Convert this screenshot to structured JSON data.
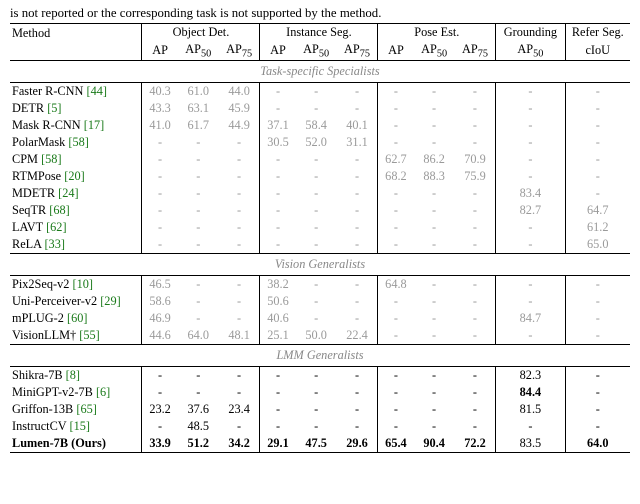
{
  "caption_tail": "is not reported or the corresponding task is not supported by the method.",
  "headers": {
    "method": "Method",
    "objdet": "Object Det.",
    "instseg": "Instance Seg.",
    "pose": "Pose Est.",
    "grounding": "Grounding",
    "referseg": "Refer Seg.",
    "ap": "AP",
    "ap50": "AP",
    "ap50_sub": "50",
    "ap75": "AP",
    "ap75_sub": "75",
    "ciou": "cIoU"
  },
  "sections": [
    {
      "title": "Task-specific Specialists",
      "rows": [
        {
          "name": "Faster R-CNN",
          "ref": "[44]",
          "gray": true,
          "od": [
            "40.3",
            "61.0",
            "44.0"
          ],
          "is": [
            "-",
            "-",
            "-"
          ],
          "pe": [
            "-",
            "-",
            "-"
          ],
          "gnd": "-",
          "ref_v": "-"
        },
        {
          "name": "DETR",
          "ref": "[5]",
          "gray": true,
          "od": [
            "43.3",
            "63.1",
            "45.9"
          ],
          "is": [
            "-",
            "-",
            "-"
          ],
          "pe": [
            "-",
            "-",
            "-"
          ],
          "gnd": "-",
          "ref_v": "-"
        },
        {
          "name": "Mask R-CNN",
          "ref": "[17]",
          "gray": true,
          "od": [
            "41.0",
            "61.7",
            "44.9"
          ],
          "is": [
            "37.1",
            "58.4",
            "40.1"
          ],
          "pe": [
            "-",
            "-",
            "-"
          ],
          "gnd": "-",
          "ref_v": "-"
        },
        {
          "name": "PolarMask",
          "ref": "[58]",
          "gray": true,
          "od": [
            "-",
            "-",
            "-"
          ],
          "is": [
            "30.5",
            "52.0",
            "31.1"
          ],
          "pe": [
            "-",
            "-",
            "-"
          ],
          "gnd": "-",
          "ref_v": "-"
        },
        {
          "name": "CPM",
          "ref": "[58]",
          "gray": true,
          "od": [
            "-",
            "-",
            "-"
          ],
          "is": [
            "-",
            "-",
            "-"
          ],
          "pe": [
            "62.7",
            "86.2",
            "70.9"
          ],
          "gnd": "-",
          "ref_v": "-"
        },
        {
          "name": "RTMPose",
          "ref": "[20]",
          "gray": true,
          "od": [
            "-",
            "-",
            "-"
          ],
          "is": [
            "-",
            "-",
            "-"
          ],
          "pe": [
            "68.2",
            "88.3",
            "75.9"
          ],
          "gnd": "-",
          "ref_v": "-"
        },
        {
          "name": "MDETR",
          "ref": "[24]",
          "gray": true,
          "od": [
            "-",
            "-",
            "-"
          ],
          "is": [
            "-",
            "-",
            "-"
          ],
          "pe": [
            "-",
            "-",
            "-"
          ],
          "gnd": "83.4",
          "ref_v": "-"
        },
        {
          "name": "SeqTR",
          "ref": "[68]",
          "gray": true,
          "od": [
            "-",
            "-",
            "-"
          ],
          "is": [
            "-",
            "-",
            "-"
          ],
          "pe": [
            "-",
            "-",
            "-"
          ],
          "gnd": "82.7",
          "ref_v": "64.7"
        },
        {
          "name": "LAVT",
          "ref": "[62]",
          "gray": true,
          "od": [
            "-",
            "-",
            "-"
          ],
          "is": [
            "-",
            "-",
            "-"
          ],
          "pe": [
            "-",
            "-",
            "-"
          ],
          "gnd": "-",
          "ref_v": "61.2"
        },
        {
          "name": "ReLA",
          "ref": "[33]",
          "gray": true,
          "od": [
            "-",
            "-",
            "-"
          ],
          "is": [
            "-",
            "-",
            "-"
          ],
          "pe": [
            "-",
            "-",
            "-"
          ],
          "gnd": "-",
          "ref_v": "65.0"
        }
      ]
    },
    {
      "title": "Vision Generalists",
      "rows": [
        {
          "name": "Pix2Seq-v2",
          "ref": "[10]",
          "gray": true,
          "od": [
            "46.5",
            "-",
            "-"
          ],
          "is": [
            "38.2",
            "-",
            "-"
          ],
          "pe": [
            "64.8",
            "-",
            "-"
          ],
          "gnd": "-",
          "ref_v": "-"
        },
        {
          "name": "Uni-Perceiver-v2",
          "ref": "[29]",
          "gray": true,
          "od": [
            "58.6",
            "-",
            "-"
          ],
          "is": [
            "50.6",
            "-",
            "-"
          ],
          "pe": [
            "-",
            "-",
            "-"
          ],
          "gnd": "-",
          "ref_v": "-"
        },
        {
          "name": "mPLUG-2",
          "ref": "[60]",
          "gray": true,
          "od": [
            "46.9",
            "-",
            "-"
          ],
          "is": [
            "40.6",
            "-",
            "-"
          ],
          "pe": [
            "-",
            "-",
            "-"
          ],
          "gnd": "84.7",
          "ref_v": "-"
        },
        {
          "name": "VisionLLM†",
          "ref": "[55]",
          "gray": true,
          "od": [
            "44.6",
            "64.0",
            "48.1"
          ],
          "is": [
            "25.1",
            "50.0",
            "22.4"
          ],
          "pe": [
            "-",
            "-",
            "-"
          ],
          "gnd": "-",
          "ref_v": "-"
        }
      ]
    },
    {
      "title": "LMM Generalists",
      "rows": [
        {
          "name": "Shikra-7B",
          "ref": "[8]",
          "gray": false,
          "od": [
            "-",
            "-",
            "-"
          ],
          "is": [
            "-",
            "-",
            "-"
          ],
          "pe": [
            "-",
            "-",
            "-"
          ],
          "gnd": "82.3",
          "ref_v": "-"
        },
        {
          "name": "MiniGPT-v2-7B",
          "ref": "[6]",
          "gray": false,
          "od": [
            "-",
            "-",
            "-"
          ],
          "is": [
            "-",
            "-",
            "-"
          ],
          "pe": [
            "-",
            "-",
            "-"
          ],
          "gnd": "84.4",
          "gnd_bold": true,
          "ref_v": "-"
        },
        {
          "name": "Griffon-13B",
          "ref": "[65]",
          "gray": false,
          "od": [
            "23.2",
            "37.6",
            "23.4"
          ],
          "is": [
            "-",
            "-",
            "-"
          ],
          "pe": [
            "-",
            "-",
            "-"
          ],
          "gnd": "81.5",
          "ref_v": "-"
        },
        {
          "name": "InstructCV",
          "ref": "[15]",
          "gray": false,
          "od": [
            "-",
            "48.5",
            "-"
          ],
          "is": [
            "-",
            "-",
            "-"
          ],
          "pe": [
            "-",
            "-",
            "-"
          ],
          "gnd": "-",
          "ref_v": "-"
        },
        {
          "name": "Lumen-7B (Ours)",
          "ref": "",
          "gray": false,
          "bold": true,
          "od": [
            "33.9",
            "51.2",
            "34.2"
          ],
          "is": [
            "29.1",
            "47.5",
            "29.6"
          ],
          "pe": [
            "65.4",
            "90.4",
            "72.2"
          ],
          "gnd": "83.5",
          "ref_v": "64.0",
          "ref_v_bold": true
        }
      ]
    }
  ]
}
